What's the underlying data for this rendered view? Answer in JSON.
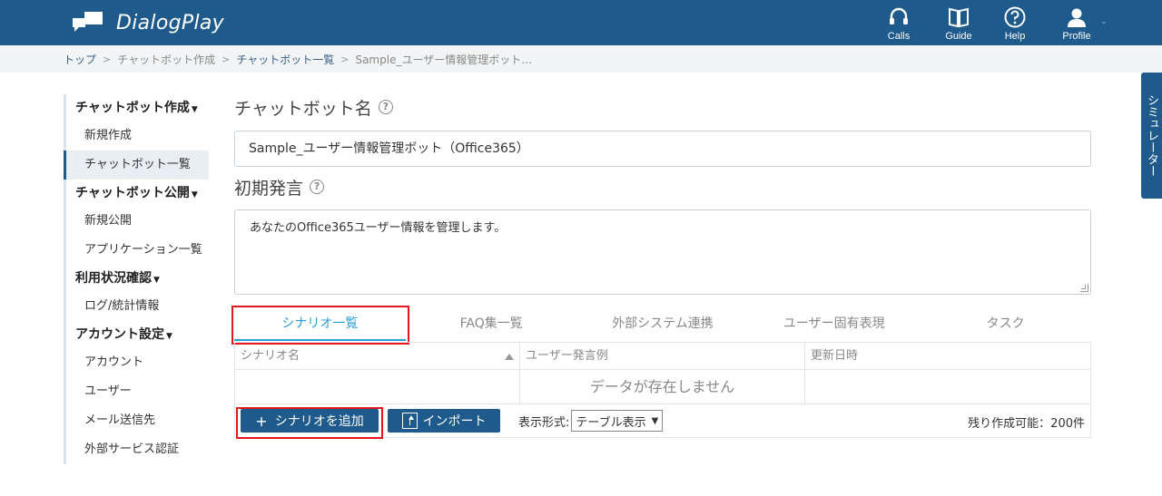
{
  "app": {
    "name": "DialogPlay"
  },
  "header_nav": [
    {
      "label": "Calls",
      "icon": "headset-icon"
    },
    {
      "label": "Guide",
      "icon": "book-icon"
    },
    {
      "label": "Help",
      "icon": "help-icon"
    },
    {
      "label": "Profile",
      "icon": "user-icon"
    }
  ],
  "breadcrumb": {
    "items": [
      "トップ",
      "チャットボット作成",
      "チャットボット一覧"
    ],
    "current": "Sample_ユーザー情報管理ボット…"
  },
  "sidebar": {
    "groups": [
      {
        "title": "チャットボット作成",
        "items": [
          "新規作成",
          "チャットボット一覧"
        ]
      },
      {
        "title": "チャットボット公開",
        "items": [
          "新規公開",
          "アプリケーション一覧"
        ]
      },
      {
        "title": "利用状況確認",
        "items": [
          "ログ/統計情報"
        ]
      },
      {
        "title": "アカウント設定",
        "items": [
          "アカウント",
          "ユーザー",
          "メール送信先",
          "外部サービス認証"
        ]
      }
    ],
    "active_item": "チャットボット一覧"
  },
  "form": {
    "bot_name_label": "チャットボット名",
    "bot_name_value": "Sample_ユーザー情報管理ボット（Office365）",
    "initial_label": "初期発言",
    "initial_value": "あなたのOffice365ユーザー情報を管理します。"
  },
  "tabs": [
    "シナリオ一覧",
    "FAQ集一覧",
    "外部システム連携",
    "ユーザー固有表現",
    "タスク"
  ],
  "table": {
    "columns": [
      "シナリオ名",
      "ユーザー発言例",
      "更新日時"
    ],
    "empty_message": "データが存在しません"
  },
  "footer": {
    "add_button": "シナリオを追加",
    "import_button": "インポート",
    "display_label": "表示形式:",
    "display_value": "テーブル表示",
    "remaining": "残り作成可能：200件"
  },
  "simulator": {
    "label": "シミュレーター"
  },
  "colors": {
    "primary": "#1e5a8b",
    "accent": "#2a9fd6",
    "highlight": "#e3161f"
  }
}
